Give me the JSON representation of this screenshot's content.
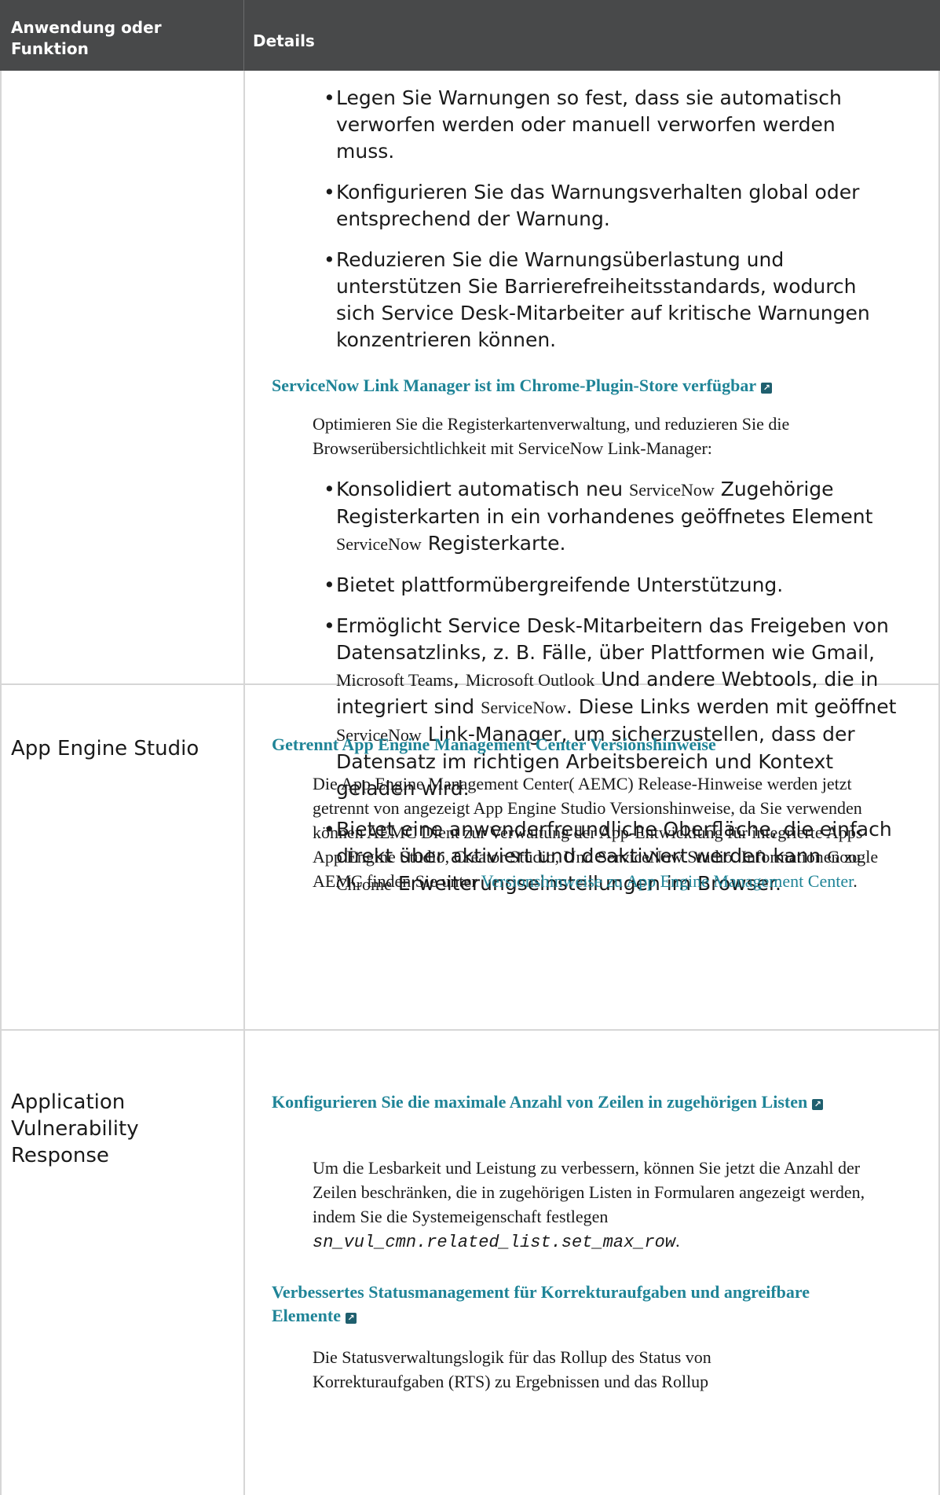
{
  "header": {
    "col1": "Anwendung oder Funktion",
    "col2": "Details"
  },
  "row1": {
    "bullets_top": [
      "Legen Sie Warnungen so fest, dass sie automatisch verworfen werden oder manuell verworfen werden muss.",
      "Konfigurieren Sie das Warnungsverhalten global oder entsprechend der Warnung.",
      "Reduzieren Sie die Warnungsüberlastung und unterstützen Sie Barrierefreiheitsstandards, wodurch sich Service Desk-Mitarbeiter auf kritische Warnungen konzentrieren können."
    ],
    "link_heading": "ServiceNow Link Manager ist im Chrome-Plugin-Store verfügbar",
    "intro": "Optimieren Sie die Registerkartenverwaltung, und reduzieren Sie die Browserübersichtlichkeit mit ServiceNow Link-Manager:",
    "b1": {
      "a": "Konsolidiert automatisch neu ",
      "s1": "ServiceNow",
      "b": " Zugehörige Registerkarten in ein vorhandenes geöffnetes Element ",
      "s2": "ServiceNow",
      "c": " Registerkarte."
    },
    "b2": "Bietet plattformübergreifende Unterstützung.",
    "b3": {
      "a": "Ermöglicht Service Desk-Mitarbeitern das Freigeben von Datensatzlinks, z. B. Fälle, über Plattformen wie Gmail, ",
      "s1": "Microsoft Teams",
      "b": ", ",
      "s2": "Microsoft Outlook",
      "c": " Und andere Webtools, die in integriert sind ",
      "s3": "ServiceNow",
      "d": ". Diese Links werden mit geöffnet ",
      "s4": "ServiceNow",
      "e": " Link-Manager, um sicherzustellen, dass der Datensatz im richtigen Arbeitsbereich und Kontext geladen wird."
    },
    "b4": {
      "a": "Bietet eine anwenderfreundliche Oberfläche, die einfach direkt über aktiviert und deaktiviert werden kann ",
      "s1": "Google Chrome",
      "b": " Erweiterungseinstellungen im Browser."
    }
  },
  "row2": {
    "label": "App Engine Studio",
    "heading": "Getrennt App Engine Management Center Versionshinweise",
    "text": "Die App Engine Management Center( AEMC) Release-Hinweise werden jetzt getrennt von angezeigt App Engine Studio Versionshinweise, da Sie verwenden können AEMC Dient zur Verwaltung der App-Entwicklung für integrierte Apps App Engine Studio, Creator Studio, Und ServiceNow Studio. Informationen zu AEMC finden Sie unter ",
    "link": "Versionshinweise zu App Engine Management Center",
    "tail": "."
  },
  "row3": {
    "label": "Application Vulnerability Response",
    "heading1": "Konfigurieren Sie die maximale Anzahl von Zeilen in zugehörigen Listen",
    "text1": "Um die Lesbarkeit und Leistung zu verbessern, können Sie jetzt die Anzahl der Zeilen beschränken, die in zugehörigen Listen in Formularen angezeigt werden, indem Sie die Systemeigenschaft festlegen ",
    "code1": "sn_vul_cmn.related_list.set_max_row",
    "tail1": ".",
    "heading2": "Verbessertes Statusmanagement für Korrekturaufgaben und angreifbare Elemente",
    "text2": "Die Statusverwaltungslogik für das Rollup des Status von Korrekturaufgaben (RTS) zu Ergebnissen und das Rollup"
  },
  "icons": {
    "external": "external-link-icon"
  },
  "colors": {
    "header_bg": "#48494a",
    "link": "#1f8497",
    "border": "#d6d6d6"
  }
}
